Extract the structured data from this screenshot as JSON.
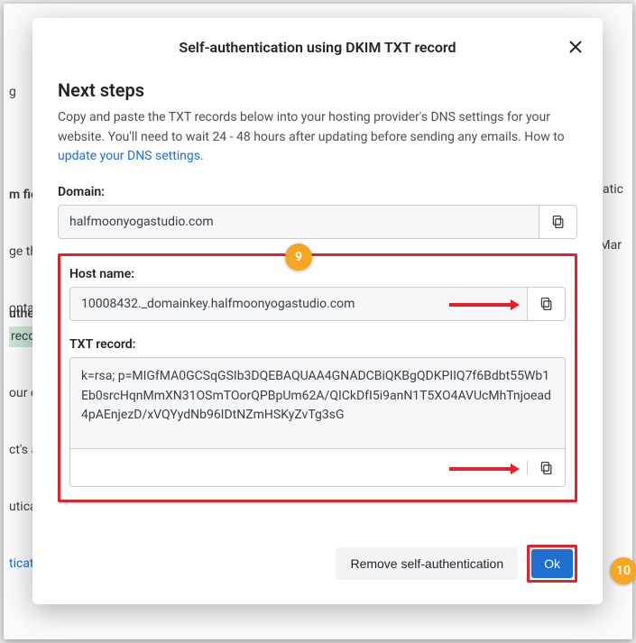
{
  "modal": {
    "title": "Self-authentication using DKIM TXT record",
    "heading": "Next steps",
    "intro_1": "Copy and paste the TXT records below into your hosting provider's DNS settings for your website. You'll need to wait 24 - 48 hours after updating before sending any emails. How to ",
    "intro_link": "update your DNS settings",
    "intro_2": ".",
    "domain_label": "Domain:",
    "domain_value": "halfmoonyogastudio.com",
    "host_label": "Host name:",
    "host_value": "10008432._domainkey.halfmoonyogastudio.com",
    "txt_label": "TXT record:",
    "txt_value": "k=rsa; p=MIGfMA0GCSqGSIb3DQEBAQUAA4GNADCBiQKBgQDKPIIQ7f6Bdbt55Wb1Eb0srcHqnMmXN31OSmTOorQPBpUm62A/QICkDfI5i9anN1T5XO4AVUcMhTnjoead4pAEnjezD/xVQYydNb96IDtNZmHSKyZvTg3sG",
    "remove_label": "Remove self-authentication",
    "ok_label": "Ok"
  },
  "badges": {
    "nine": "9",
    "ten": "10"
  },
  "background": {
    "g": "g",
    "mar": "Mar",
    "m_field": "m fiel",
    "line2a": "ge the",
    "line2b": "ontac",
    "auth": "uthent",
    "record": "recor",
    "l1": "our o",
    "l2": "ct's al",
    "l3": "uticati",
    "l4": "ticati",
    "matic": "matic"
  }
}
